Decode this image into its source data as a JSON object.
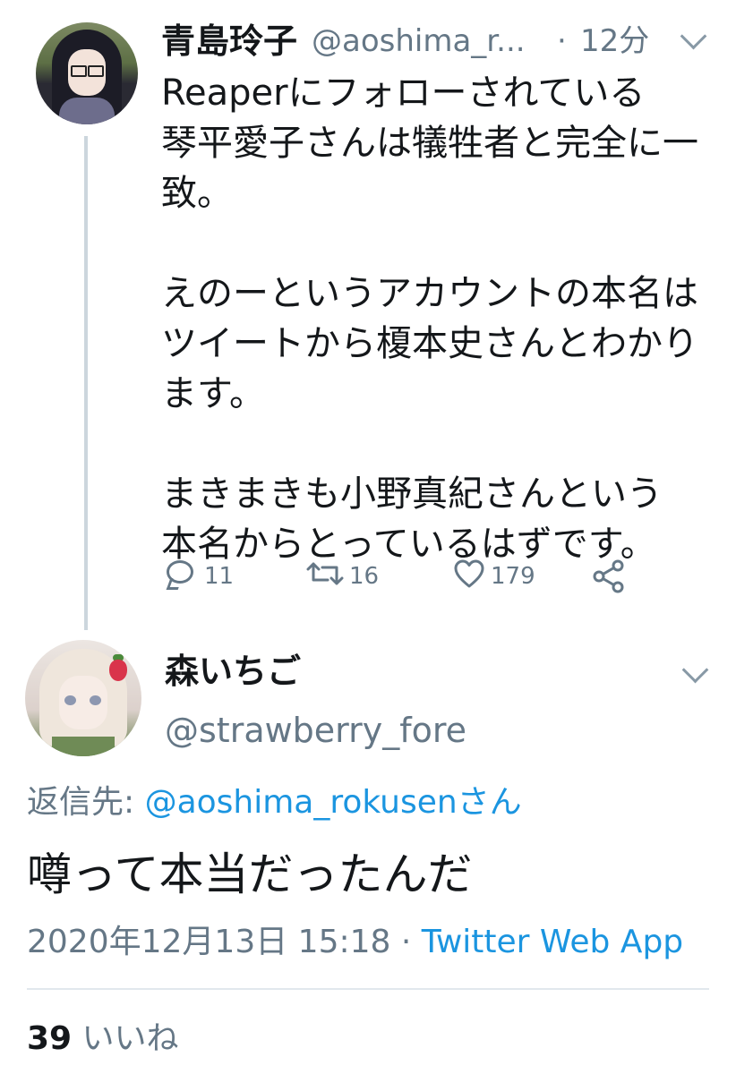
{
  "tweet1": {
    "display_name": "青島玲子",
    "handle": "@aoshima_r...",
    "separator": "·",
    "time": "12分",
    "lines": [
      "Reaperにフォローされている",
      "琴平愛子さんは犠牲者と完全に一",
      "致。",
      "",
      "えのーというアカウントの本名は",
      "ツイートから榎本史さんとわかり",
      "ます。",
      "",
      "まきまきも小野真紀さんという",
      "本名からとっているはずです。"
    ],
    "actions": {
      "replies": "11",
      "retweets": "16",
      "likes": "179"
    }
  },
  "tweet2": {
    "display_name": "森いちご",
    "handle": "@strawberry_fore",
    "replying_prefix": "返信先: ",
    "replying_mention": "@aoshima_rokusenさん",
    "text": "噂って本当だったんだ",
    "timestamp": "2020年12月13日 15:18",
    "meta_separator": " · ",
    "source": "Twitter Web App",
    "like_count": "39",
    "like_label": " いいね"
  },
  "colors": {
    "text": "#14171a",
    "muted": "#657786",
    "link": "#1b95e0",
    "divider": "#e1e8ed",
    "thread_line": "#ccd6dd"
  }
}
